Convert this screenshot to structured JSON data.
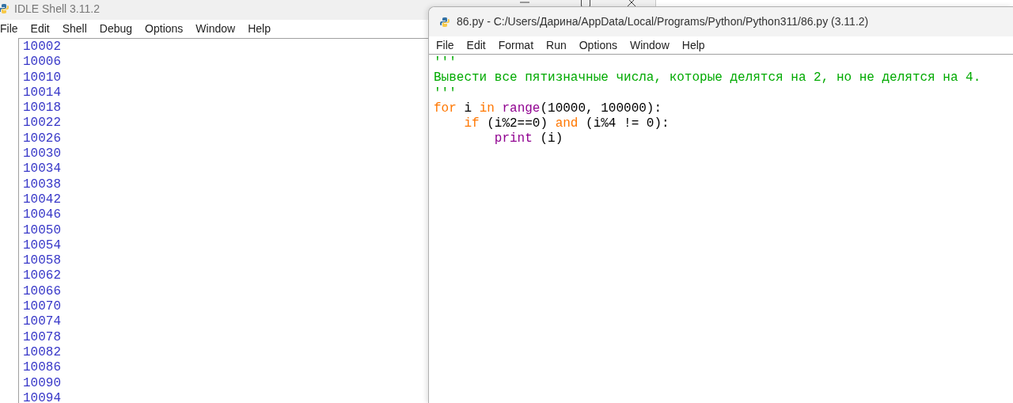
{
  "shell": {
    "title": "IDLE Shell 3.11.2",
    "menu": [
      "File",
      "Edit",
      "Shell",
      "Debug",
      "Options",
      "Window",
      "Help"
    ],
    "output": [
      "10002",
      "10006",
      "10010",
      "10014",
      "10018",
      "10022",
      "10026",
      "10030",
      "10034",
      "10038",
      "10042",
      "10046",
      "10050",
      "10054",
      "10058",
      "10062",
      "10066",
      "10070",
      "10074",
      "10078",
      "10082",
      "10086",
      "10090",
      "10094"
    ]
  },
  "editor": {
    "title": "86.py - C:/Users/Дарина/AppData/Local/Programs/Python/Python311/86.py (3.11.2)",
    "menu": [
      "File",
      "Edit",
      "Format",
      "Run",
      "Options",
      "Window",
      "Help"
    ],
    "code": [
      [
        {
          "text": "'''",
          "kind": "string"
        }
      ],
      [
        {
          "text": "Вывести все пятизначные числа, которые делятся на 2, но не делятся на 4.",
          "kind": "string"
        }
      ],
      [
        {
          "text": "'''",
          "kind": "string"
        }
      ],
      [
        {
          "text": "for",
          "kind": "keyword"
        },
        {
          "text": " i ",
          "kind": "plain"
        },
        {
          "text": "in",
          "kind": "keyword"
        },
        {
          "text": " range",
          "kind": "builtin"
        },
        {
          "text": "(10000, 100000):",
          "kind": "plain"
        }
      ],
      [
        {
          "text": "    if",
          "kind": "keyword"
        },
        {
          "text": " (i%2==0) ",
          "kind": "plain"
        },
        {
          "text": "and",
          "kind": "keyword"
        },
        {
          "text": " (i%4 != 0):",
          "kind": "plain"
        }
      ],
      [
        {
          "text": "        print",
          "kind": "builtin"
        },
        {
          "text": " (i)",
          "kind": "plain"
        }
      ]
    ]
  }
}
